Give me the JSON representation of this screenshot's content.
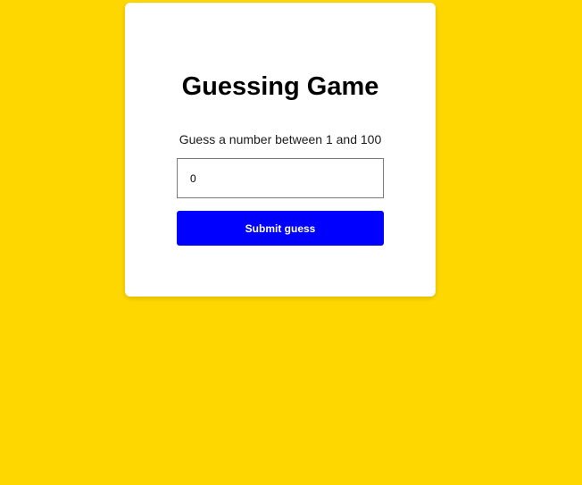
{
  "colors": {
    "background": "#FFD700",
    "card": "#FFFFFF",
    "button": "#0000FF",
    "button_text": "#FFFFFF"
  },
  "game": {
    "title": "Guessing Game",
    "prompt": "Guess a number between 1 and 100",
    "guess_value": "0",
    "submit_label": "Submit guess"
  }
}
